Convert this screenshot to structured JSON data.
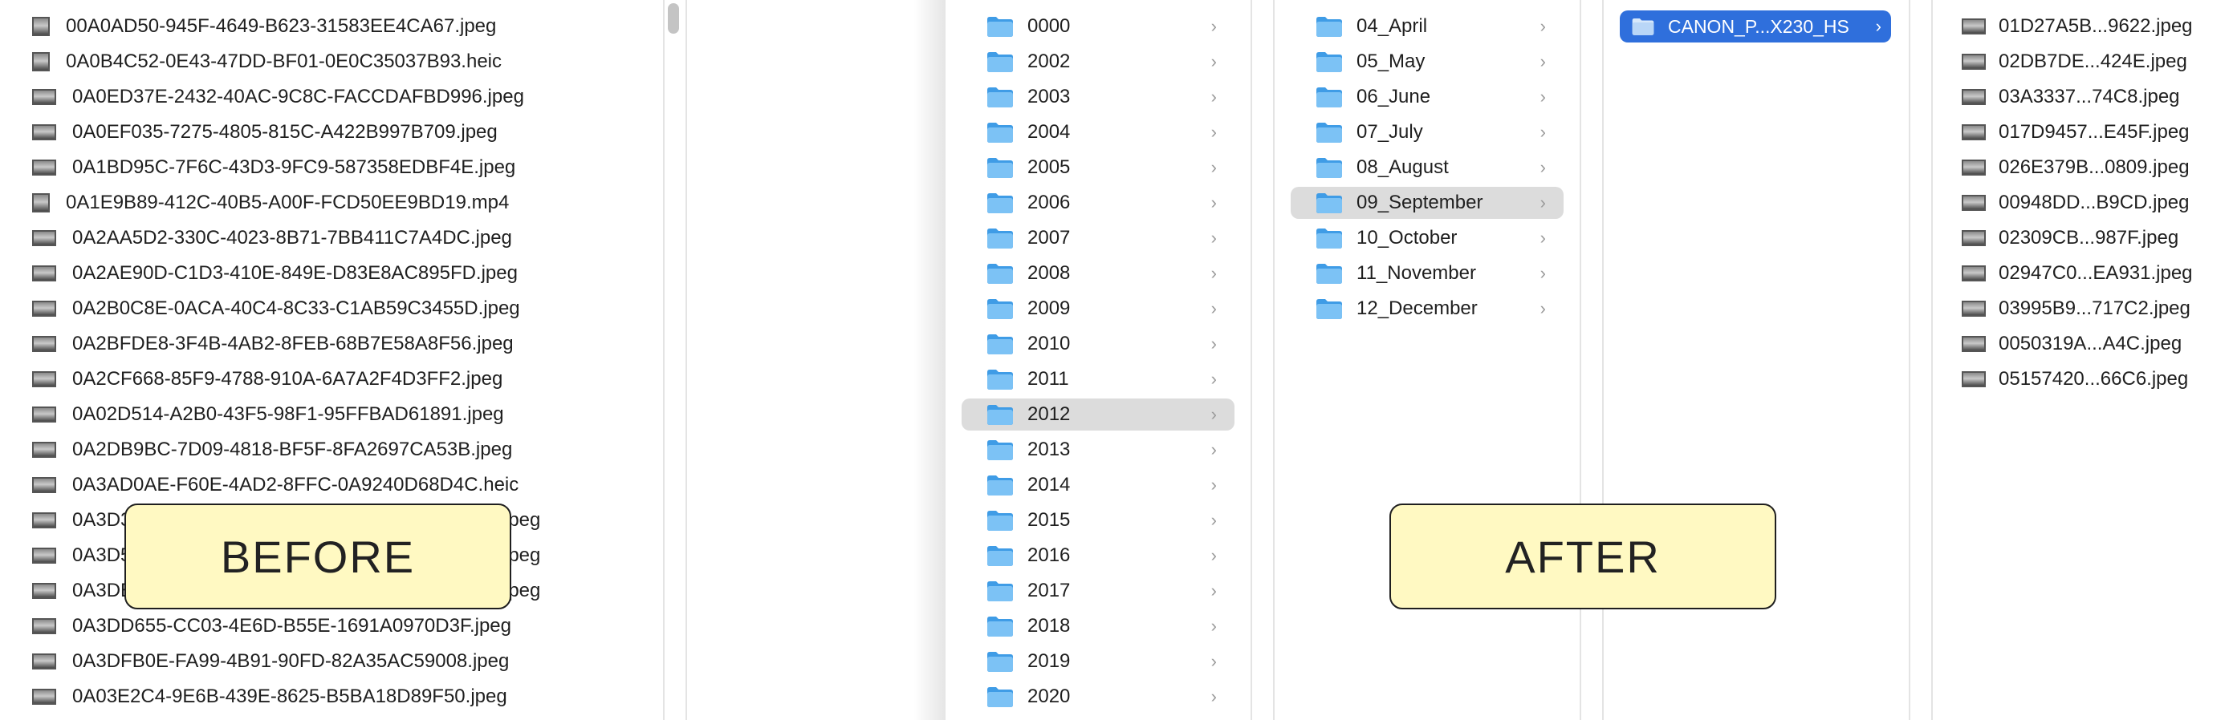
{
  "before_files": [
    {
      "name": "00A0AD50-945F-4649-B623-31583EE4CA67.jpeg",
      "icon": "portrait-photo-thumbnail-icon"
    },
    {
      "name": "0A0B4C52-0E43-47DD-BF01-0E0C35037B93.heic",
      "icon": "portrait-photo-thumbnail-icon"
    },
    {
      "name": "0A0ED37E-2432-40AC-9C8C-FACCDAFBD996.jpeg",
      "icon": "landscape-photo-thumbnail-icon"
    },
    {
      "name": "0A0EF035-7275-4805-815C-A422B997B709.jpeg",
      "icon": "landscape-photo-thumbnail-icon"
    },
    {
      "name": "0A1BD95C-7F6C-43D3-9FC9-587358EDBF4E.jpeg",
      "icon": "landscape-photo-thumbnail-icon"
    },
    {
      "name": "0A1E9B89-412C-40B5-A00F-FCD50EE9BD19.mp4",
      "icon": "video-thumbnail-icon"
    },
    {
      "name": "0A2AA5D2-330C-4023-8B71-7BB411C7A4DC.jpeg",
      "icon": "landscape-photo-thumbnail-icon"
    },
    {
      "name": "0A2AE90D-C1D3-410E-849E-D83E8AC895FD.jpeg",
      "icon": "landscape-photo-thumbnail-icon"
    },
    {
      "name": "0A2B0C8E-0ACA-40C4-8C33-C1AB59C3455D.jpeg",
      "icon": "landscape-photo-thumbnail-icon"
    },
    {
      "name": "0A2BFDE8-3F4B-4AB2-8FEB-68B7E58A8F56.jpeg",
      "icon": "landscape-photo-thumbnail-icon"
    },
    {
      "name": "0A2CF668-85F9-4788-910A-6A7A2F4D3FF2.jpeg",
      "icon": "landscape-photo-thumbnail-icon"
    },
    {
      "name": "0A02D514-A2B0-43F5-98F1-95FFBAD61891.jpeg",
      "icon": "landscape-photo-thumbnail-icon"
    },
    {
      "name": "0A2DB9BC-7D09-4818-BF5F-8FA2697CA53B.jpeg",
      "icon": "landscape-photo-thumbnail-icon"
    },
    {
      "name": "0A3AD0AE-F60E-4AD2-8FFC-0A9240D68D4C.heic",
      "icon": "landscape-photo-thumbnail-icon"
    },
    {
      "name": "0A3D3",
      "name_tail": "jpeg",
      "icon": "landscape-photo-thumbnail-icon"
    },
    {
      "name": "0A3D5",
      "name_tail": "jpeg",
      "icon": "landscape-photo-thumbnail-icon"
    },
    {
      "name": "0A3DE",
      "name_tail": "jpeg",
      "icon": "landscape-photo-thumbnail-icon"
    },
    {
      "name": "0A3DD655-CC03-4E6D-B55E-1691A0970D3F.jpeg",
      "icon": "landscape-photo-thumbnail-icon"
    },
    {
      "name": "0A3DFB0E-FA99-4B91-90FD-82A35AC59008.jpeg",
      "icon": "landscape-photo-thumbnail-icon"
    },
    {
      "name": "0A03E2C4-9E6B-439E-8625-B5BA18D89F50.jpeg",
      "icon": "landscape-photo-thumbnail-icon"
    }
  ],
  "before_label": "BEFORE",
  "after_label": "AFTER",
  "years": [
    "0000",
    "2002",
    "2003",
    "2004",
    "2005",
    "2006",
    "2007",
    "2008",
    "2009",
    "2010",
    "2011",
    "2012",
    "2013",
    "2014",
    "2015",
    "2016",
    "2017",
    "2018",
    "2019",
    "2020"
  ],
  "selected_year": "2012",
  "months": [
    "04_April",
    "05_May",
    "06_June",
    "07_July",
    "08_August",
    "09_September",
    "10_October",
    "11_November",
    "12_December"
  ],
  "selected_month": "09_September",
  "camera_folder": "CANON_P...X230_HS",
  "after_files": [
    "01D27A5B...9622.jpeg",
    "02DB7DE...424E.jpeg",
    "03A3337...74C8.jpeg",
    "017D9457...E45F.jpeg",
    "026E379B...0809.jpeg",
    "00948DD...B9CD.jpeg",
    "02309CB...987F.jpeg",
    "02947C0...EA931.jpeg",
    "03995B9...717C2.jpeg",
    "0050319A...A4C.jpeg",
    "05157420...66C6.jpeg"
  ],
  "colors": {
    "folder": "#5fb3ef",
    "selection_blue": "#2f6fdc",
    "selection_gray": "#dcdcdc",
    "label_bg": "#fff9c2"
  }
}
